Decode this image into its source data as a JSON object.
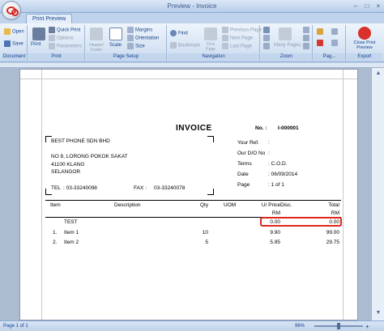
{
  "window": {
    "title": "Preview - Invoice",
    "minimize": "–",
    "maximize": "□",
    "close": "×"
  },
  "tabs": [
    {
      "label": "Print Preview"
    }
  ],
  "ribbon": {
    "document": {
      "label": "Document",
      "open": "Open",
      "save": "Save"
    },
    "print": {
      "label": "Print",
      "print": "Print",
      "quick_print": "Quick Print",
      "options": "Options",
      "parameters": "Parameters"
    },
    "page_setup": {
      "label": "Page Setup",
      "header_footer": "Header/ Footer",
      "scale": "Scale",
      "margins": "Margins",
      "orientation": "Orientation",
      "size": "Size"
    },
    "navigation": {
      "label": "Navigation",
      "find": "Find",
      "bookmark": "Bookmark",
      "first_page": "First Page",
      "previous_page": "Previous Page",
      "next_page": "Next Page",
      "last_page": "Last Page"
    },
    "zoom": {
      "label": "Zoom",
      "many_pages": "Many Pages"
    },
    "page_background": {
      "label": "Pag..."
    },
    "export": {
      "label": "Export",
      "close_print_preview": "Close Print Preview"
    }
  },
  "invoice": {
    "title": "INVOICE",
    "no_label": "No. :",
    "no_value": "I-000001",
    "customer": {
      "name": "BEST PHONE SDN BHD",
      "addr1": "NO 8, LORONG POKOK SAKAT",
      "addr2": "41100 KLANG",
      "addr3": "SELANGOR",
      "tel_label": "TEL",
      "tel": ": 03-33240098",
      "fax_label": "FAX :",
      "fax": "03-33240078"
    },
    "meta": [
      {
        "label": "Your Ref.",
        "value": ":"
      },
      {
        "label": "Our D/O No",
        "value": ":"
      },
      {
        "label": "Terms",
        "value": ":  C.O.D."
      },
      {
        "label": "Date",
        "value": ":  06/09/2014"
      },
      {
        "label": "Page",
        "value": ":  1 of 1"
      }
    ],
    "columns": {
      "item": "Item",
      "description": "Description",
      "qty": "Qty",
      "uom": "UOM",
      "unit_price": "U/ Price",
      "unit_price_unit": "RM",
      "disc": "Disc.",
      "total": "Total",
      "total_unit": "RM"
    },
    "rows": [
      {
        "num": "",
        "desc": "TEST",
        "qty": "",
        "price": "0.00",
        "total": "0.00"
      },
      {
        "num": "1.",
        "desc": "Item 1",
        "qty": "10",
        "price": "9.90",
        "total": "99.00"
      },
      {
        "num": "2.",
        "desc": "Item 2",
        "qty": "5",
        "price": "5.95",
        "total": "29.75"
      }
    ]
  },
  "status": {
    "page": "Page 1 of 1",
    "zoom": "96%"
  },
  "colors": {
    "highlight": "#e1251b",
    "ribbon": "#d5e3f3"
  }
}
